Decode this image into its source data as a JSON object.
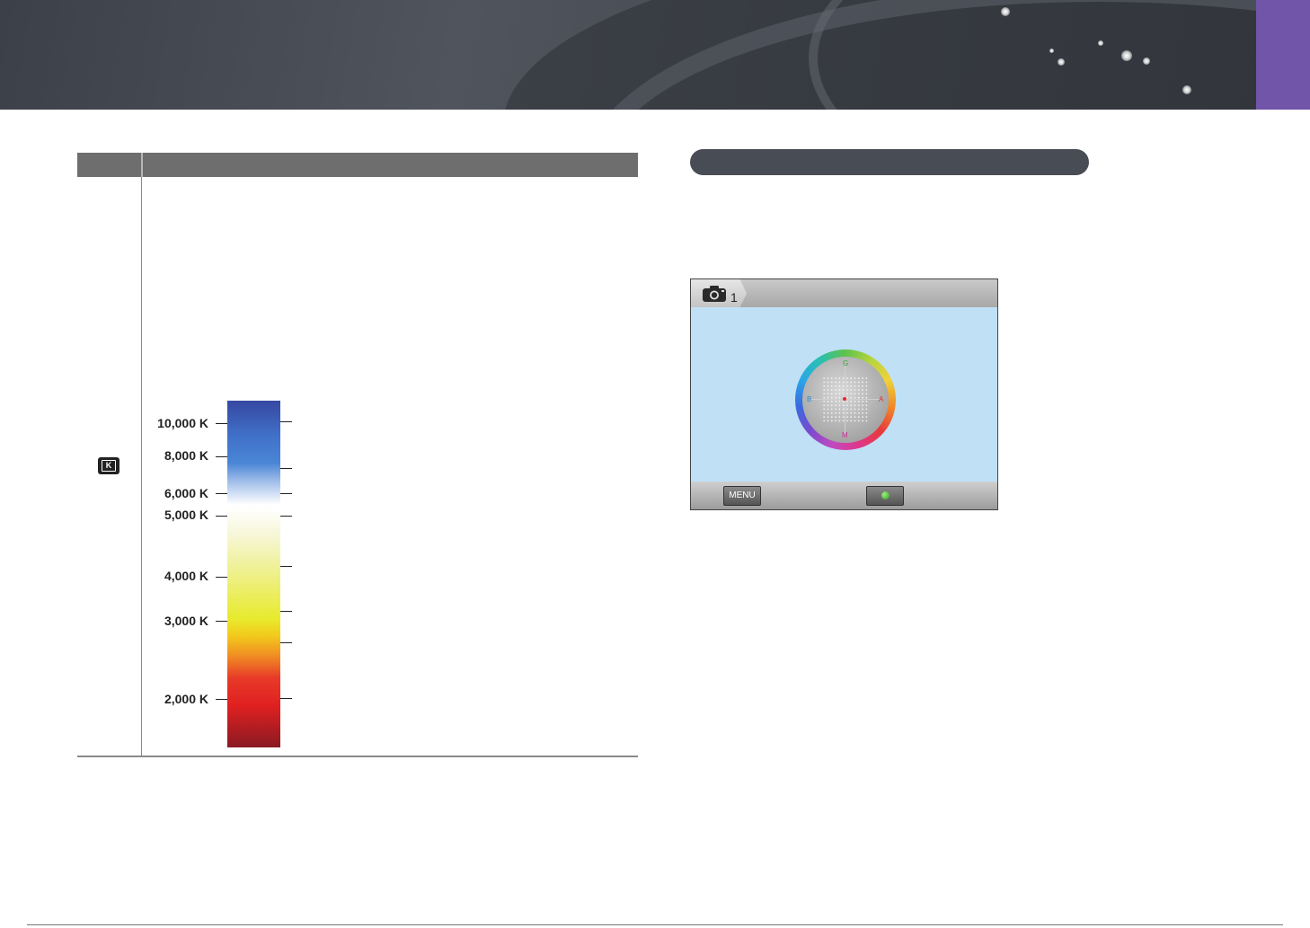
{
  "header": {
    "colors": {
      "banner": "#474b53",
      "tab": "#7055a8"
    }
  },
  "table": {
    "row_icon": "k-mode-icon",
    "row_icon_text": "K",
    "kelvin_scale": {
      "labels": [
        "10,000 K",
        "8,000 K",
        "6,000 K",
        "5,000 K",
        "4,000 K",
        "3,000 K",
        "2,000 K"
      ]
    }
  },
  "screen": {
    "camera_icon": "camera-icon",
    "camera_number": "1",
    "menu_label": "MENU",
    "reset_icon": "reset-icon",
    "wheel": {
      "top": "G",
      "left": "B",
      "right": "A",
      "bottom": "M"
    }
  }
}
